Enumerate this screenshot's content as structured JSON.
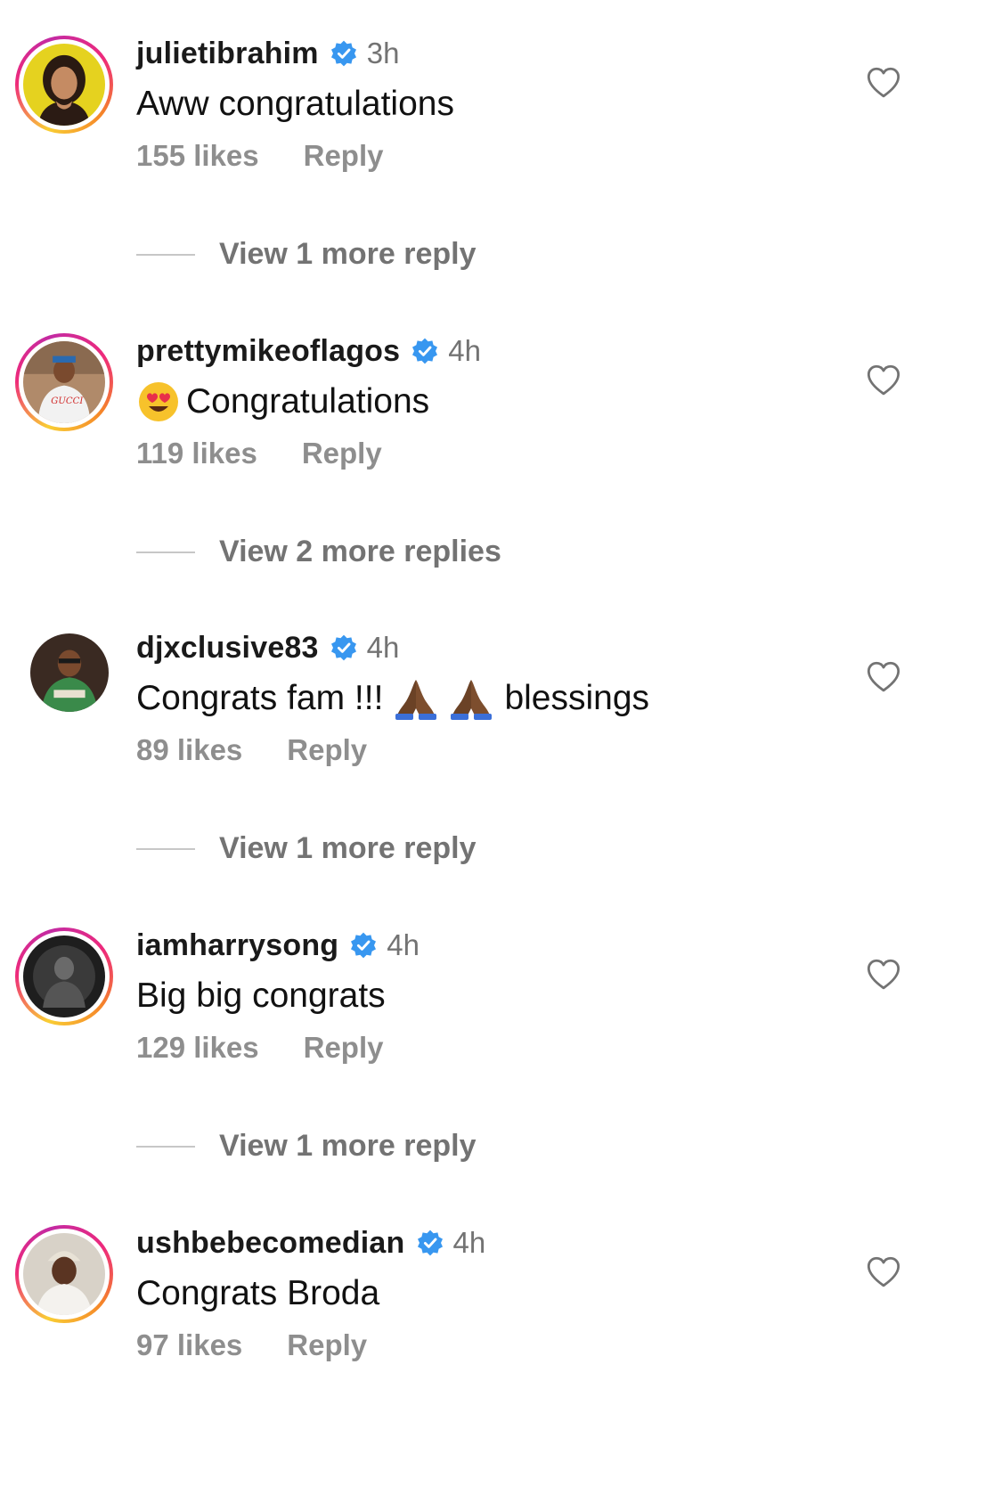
{
  "comments": [
    {
      "username": "julietibrahim",
      "time": "3h",
      "text": "Aww congratulations",
      "likes": "155 likes",
      "reply_label": "Reply",
      "view_more": "View 1 more reply",
      "avatar_ring": "story"
    },
    {
      "username": "prettymikeoflagos",
      "time": "4h",
      "text": "Congratulations",
      "text_emoji": "smiling-face-with-heart-eyes",
      "likes": "119 likes",
      "reply_label": "Reply",
      "view_more": "View 2 more replies",
      "avatar_ring": "story"
    },
    {
      "username": "djxclusive83",
      "time": "4h",
      "text": "Congrats fam !!!",
      "text_suffix": "blessings",
      "text_emoji": "folded-hands-dark-skin",
      "likes": "89 likes",
      "reply_label": "Reply",
      "view_more": "View 1 more reply",
      "avatar_ring": "none"
    },
    {
      "username": "iamharrysong",
      "time": "4h",
      "text": "Big big congrats",
      "likes": "129 likes",
      "reply_label": "Reply",
      "view_more": "View 1 more reply",
      "avatar_ring": "story"
    },
    {
      "username": "ushbebecomedian",
      "time": "4h",
      "text": "Congrats Broda",
      "likes": "97 likes",
      "reply_label": "Reply",
      "avatar_ring": "story"
    }
  ],
  "icons": {
    "verified": "verified-badge-icon",
    "like": "heart-outline-icon"
  },
  "colors": {
    "verified_blue": "#3897f0",
    "secondary_text": "#8e8e8e",
    "divider": "#c7c7c7"
  }
}
